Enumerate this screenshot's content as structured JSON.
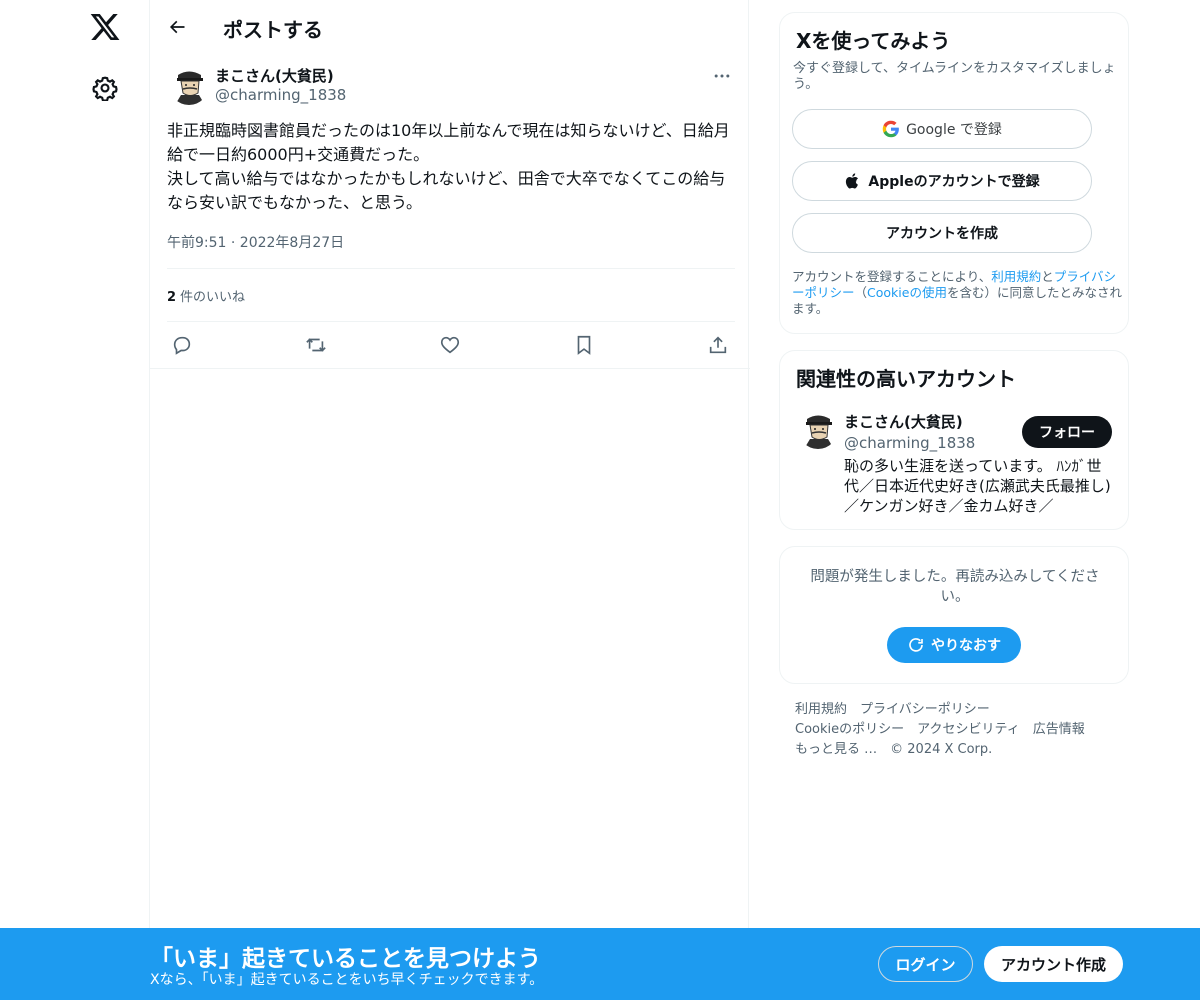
{
  "nav": {
    "logo_icon": "x-logo-icon",
    "settings_icon": "gear-icon"
  },
  "header": {
    "title": "ポストする",
    "back_icon": "arrow-left-icon"
  },
  "tweet": {
    "author_name": "まこさん(大貧民)",
    "author_handle": "@charming_1838",
    "text": "非正規臨時図書館員だったのは10年以上前なんで現在は知らないけど、日給月給で一日約6000円+交通費だった。\n決して高い給与ではなかったかもしれないけど、田舎で大卒でなくてこの給与なら安い訳でもなかった、と思う。",
    "timestamp": "午前9:51 · 2022年8月27日",
    "likes_count": "2",
    "likes_label": "件のいいね",
    "actions": [
      "reply-icon",
      "retweet-icon",
      "like-icon",
      "bookmark-icon",
      "share-icon"
    ]
  },
  "signup": {
    "title": "Xを使ってみよう",
    "subtitle": "今すぐ登録して、タイムラインをカスタマイズしましょう。",
    "google_label": "Google で登録",
    "apple_label": "Appleのアカウントで登録",
    "create_label": "アカウントを作成",
    "terms_1": "アカウントを登録することにより、",
    "terms_link_1": "利用規約",
    "terms_2": "と",
    "terms_link_2": "プライバシーポリシー",
    "terms_3": "（",
    "terms_link_3": "Cookieの使用",
    "terms_4": "を含む）に同意したとみなされます。"
  },
  "related": {
    "title": "関連性の高いアカウント",
    "name": "まこさん(大貧民)",
    "handle": "@charming_1838",
    "follow_label": "フォロー",
    "bio": "恥の多い生涯を送っています。 ﾊﾝｶﾞ世代／日本近代史好き(広瀬武夫氏最推し)／ケンガン好き／金カム好き／"
  },
  "error_card": {
    "message": "問題が発生しました。再読み込みしてください。",
    "retry_label": "やりなおす"
  },
  "footer": {
    "row1": [
      "利用規約",
      "プライバシーポリシー"
    ],
    "row2": [
      "Cookieのポリシー",
      "アクセシビリティ",
      "広告情報"
    ],
    "more": "もっと見る …",
    "copyright": "© 2024 X Corp."
  },
  "banner": {
    "title": "「いま」起きていることを見つけよう",
    "subtitle": "Xなら、「いま」起きていることをいち早くチェックできます。",
    "login_label": "ログイン",
    "signup_label": "アカウント作成"
  },
  "colors": {
    "accent": "#1d9bf0",
    "text": "#0f1419",
    "muted": "#536471",
    "border": "#eff3f4"
  }
}
